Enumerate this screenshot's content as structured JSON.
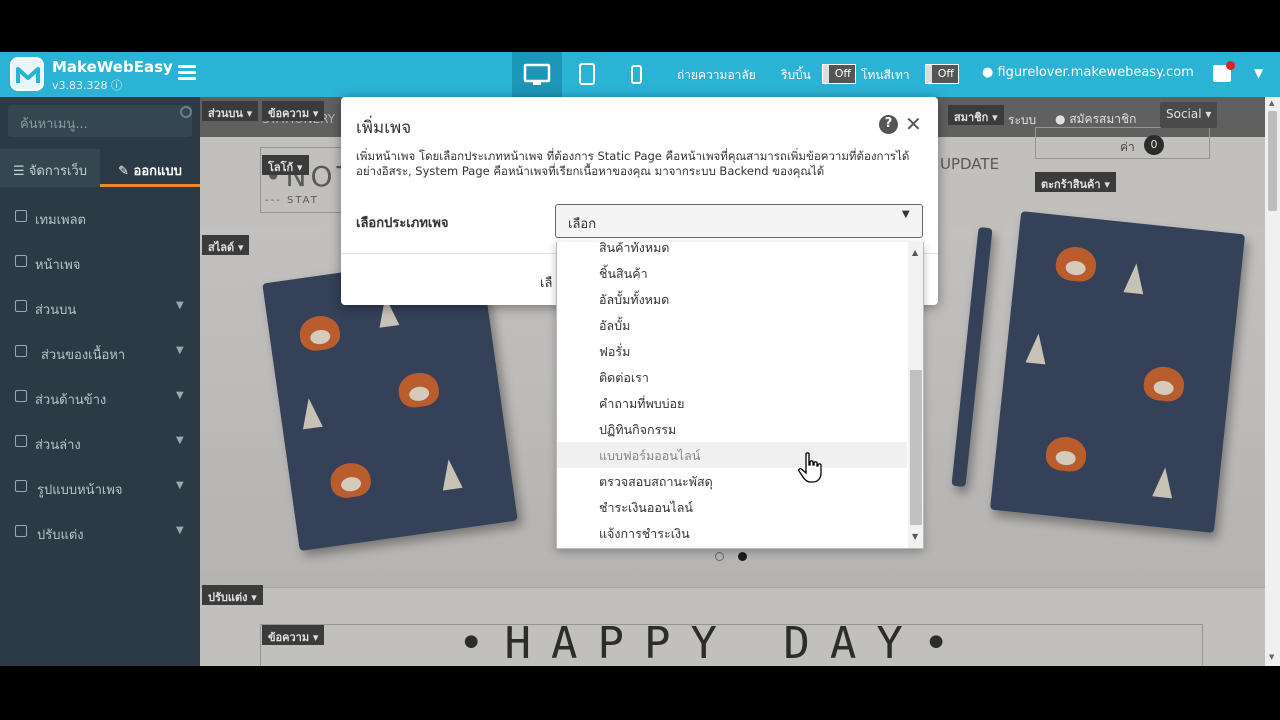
{
  "topbar": {
    "app_name": "MakeWebEasy",
    "version": "v3.83.328",
    "label_save_image": "ถ่ายความอาลัย",
    "label_ribbon": "ริบบิ้น",
    "ribbon_toggle": "Off",
    "label_gray_tone": "โทนสีเทา",
    "gray_toggle": "Off",
    "site_url": "figurelover.makewebeasy.com"
  },
  "sidebar": {
    "search_placeholder": "ค้นหาเมนู...",
    "tab_manage": "จัดการเว็บ",
    "tab_design": "ออกแบบ",
    "items": [
      {
        "label": "เทมเพลต"
      },
      {
        "label": "หน้าเพจ"
      },
      {
        "label": "ส่วนบน"
      },
      {
        "label": "ส่วนของเนื้อหา"
      },
      {
        "label": "ส่วนด้านข้าง"
      },
      {
        "label": "ส่วนล่าง"
      },
      {
        "label": "รูปแบบหน้าเพจ"
      },
      {
        "label": "ปรับแต่ง"
      }
    ]
  },
  "canvas": {
    "tag_top": "ส่วนบน ▾",
    "tag_text": "ข้อความ ▾",
    "tag_logo": "โลโก้ ▾",
    "tag_slide": "สไลด์ ▾",
    "tag_customize": "ปรับแต่ง ▾",
    "tag_text2": "ข้อความ ▾",
    "tag_member": "สมาชิก ▾",
    "tag_social": "Social ▾",
    "tag_cart": "ตะกร้าสินค้า ▾",
    "header_stationery": "STATIONERY",
    "header_login": "ระบบ",
    "header_register": "สมัครสมาชิก",
    "brand": "•NOT",
    "brand_sub": "--- STAT",
    "update": "UPDATE",
    "cart_word": "ค่า",
    "cart_count": "0",
    "happy": "•HAPPY DAY•"
  },
  "modal": {
    "title": "เพิ่มเพจ",
    "description": "เพิ่มหน้าเพจ โดยเลือกประเภทหน้าเพจ ที่ต้องการ Static Page คือหน้าเพจที่คุณสามารถเพิ่มข้อความที่ต้องการได้อย่างอิสระ, System Page คือหน้าเพจที่เรียกเนื้อหาของคุณ มาจากระบบ Backend ของคุณได้",
    "field_label": "เลือกประเภทเพจ",
    "select_value": "เลือก",
    "footer_text": "เลื"
  },
  "dropdown": {
    "items": [
      "สินค้าทั้งหมด",
      "ชิ้นสินค้า",
      "อัลบั้มทั้งหมด",
      "อัลบั้ม",
      "ฟอรั่ม",
      "ติดต่อเรา",
      "คำถามที่พบบ่อย",
      "ปฏิทินกิจกรรม",
      "แบบฟอร์มออนไลน์",
      "ตรวจสอบสถานะพัสดุ",
      "ชำระเงินออนไลน์",
      "แจ้งการชำระเงิน"
    ],
    "hovered": "แบบฟอร์มออนไลน์"
  },
  "colors": {
    "topbar": "#2bb3d6",
    "sidebar": "#2b3a44",
    "accent": "#f08a24"
  }
}
